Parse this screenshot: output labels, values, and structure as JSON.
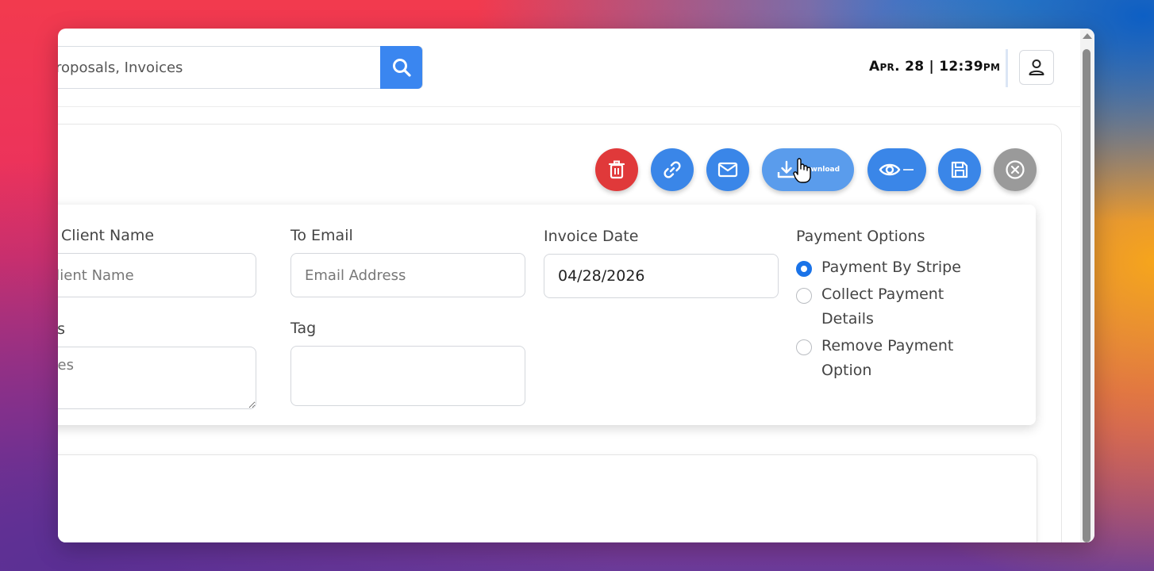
{
  "search": {
    "value": "roposals, Invoices",
    "icon": "search-icon"
  },
  "header": {
    "datetime": "Apr. 28 | 12:39pm",
    "user_icon": "user-icon"
  },
  "toolbar": {
    "delete_icon": "trash-icon",
    "link_icon": "link-icon",
    "email_icon": "mail-icon",
    "download_label": "Download",
    "download_icon": "download-icon",
    "preview_icon": "eye-icon",
    "save_icon": "save-icon",
    "close_icon": "close-circle-icon",
    "colors": {
      "delete": "#e0393a",
      "primary": "#3a86e8",
      "close": "#9a9a9a"
    }
  },
  "form": {
    "client_name_label": "Client Name",
    "client_name_placeholder": "o Client Name",
    "to_email_label": "To Email",
    "to_email_placeholder": "Email Address",
    "invoice_date_label": "Invoice Date",
    "invoice_date_value": "04/28/2026",
    "notes_label": "tes",
    "notes_placeholder": "Notes",
    "tag_label": "Tag",
    "tag_value": "",
    "payment_options_label": "Payment Options",
    "payment_options": [
      {
        "line1": "Payment By Stripe",
        "line2": "",
        "selected": true
      },
      {
        "line1": "Collect Payment",
        "line2": "Details",
        "selected": false
      },
      {
        "line1": "Remove Payment",
        "line2": "Option",
        "selected": false
      }
    ]
  }
}
